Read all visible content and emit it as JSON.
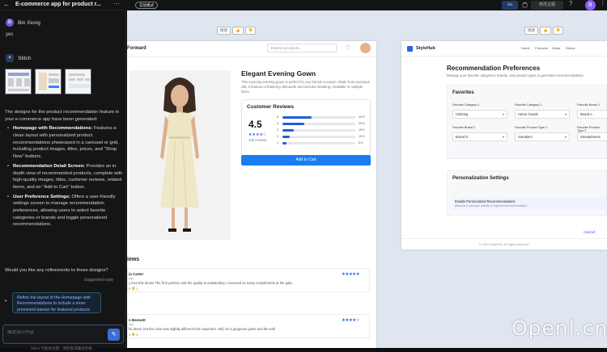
{
  "topbar": {
    "title": "E-commerce app for product r...",
    "mode_label": "实验模式",
    "blue_btn": "Aa",
    "theme_btn": "修改主题",
    "avatar": "B"
  },
  "chat": {
    "user_initial": "B",
    "user_name": "Bin Xiong",
    "user_message": "yes",
    "assistant_name": "Stitch",
    "intro": "The designs for the product recommendation feature in your e-commerce app have been generated:",
    "bullets": [
      {
        "title": "Homepage with Recommendations:",
        "body": " Features a clean layout with personalized product recommendations showcased in a carousel or grid, including product images, titles, prices, and \"Shop Now\" buttons."
      },
      {
        "title": "Recommendation Detail Screen:",
        "body": " Provides an in-depth view of recommended products, complete with high-quality images, titles, customer reviews, related items, and an \"Add to Cart\" button."
      },
      {
        "title": "User Preference Settings:",
        "body": " Offers a user-friendly settings screen to manage recommendation preferences, allowing users to select favorite categories or brands and toggle personalized recommendations."
      }
    ],
    "question": "Would you like any refinements to these designs?",
    "suggested_label": "Suggested reply",
    "suggestion": "Refine the layout of the Homepage with Recommendations to include a more prominent banner for featured products",
    "input_placeholder": "描述设计内容",
    "footer_note": "Stitch 可能会出错，请检查其输出结果。"
  },
  "frame_tools": {
    "edit": "修改"
  },
  "detail": {
    "brand": "Forward",
    "search_placeholder": "Search products...",
    "title": "Elegant Evening Gown",
    "description": "This stunning evening gown is perfect for any formal occasion. Made from luxurious silk, it features a flattering silhouette and intricate detailing. Available in multiple sizes.",
    "reviews_card_title": "Customer Reviews",
    "score": "4.5",
    "stars": "★★★★☆",
    "review_count": "125 reviews",
    "rating_rows": [
      {
        "label": "5",
        "value": 40,
        "pct": "40%"
      },
      {
        "label": "4",
        "value": 30,
        "pct": "30%"
      },
      {
        "label": "3",
        "value": 15,
        "pct": "15%"
      },
      {
        "label": "2",
        "value": 10,
        "pct": "10%"
      },
      {
        "label": "1",
        "value": 5,
        "pct": "5%"
      }
    ],
    "add_to_cart": "Add to Cart",
    "reviews_heading": "iews",
    "reviews": [
      {
        "name": "ia Carter",
        "date": "ago",
        "text": "y love this dress! The fit is perfect, and the quality is outstanding. I received so many compliments at the gala.",
        "stars": "★★★★★",
        "likes": "5  👎 1"
      },
      {
        "name": "n Bennett",
        "date": "ago",
        "text": "ful dress, but the color was slightly different from expected. Still, it's a gorgeous gown and the well",
        "stars": "★★★★☆",
        "likes": "3  👎 0"
      }
    ]
  },
  "prefs": {
    "brand": "StyleHub",
    "nav": [
      "Home",
      "Products",
      "Deals",
      "Stores"
    ],
    "title": "Recommendation Preferences",
    "subtitle": "Manage your favorite categories, brands, and product types to get better recommendations.",
    "favorites_title": "Favorites",
    "fields": [
      {
        "label": "Favorite Category 1",
        "value": "Clothing"
      },
      {
        "label": "Favorite Category 2",
        "value": "Home Goods"
      },
      {
        "label": "Favorite Brand 1",
        "value": "Brand A"
      },
      {
        "label": "Favorite Brand 2",
        "value": "Brand D"
      },
      {
        "label": "Favorite Product Type 1",
        "value": "Sneakers"
      },
      {
        "label": "Favorite Product Type 2",
        "value": "Smartphones"
      }
    ],
    "personalization_title": "Personalization Settings",
    "toggle_title": "Enable Personalized Recommendations",
    "toggle_desc": "Allow us to use your activity to improve recommendations",
    "cancel": "Cancel",
    "footer": "© 2024 StyleHub. All rights reserved."
  },
  "watermark": "Openl.cn"
}
